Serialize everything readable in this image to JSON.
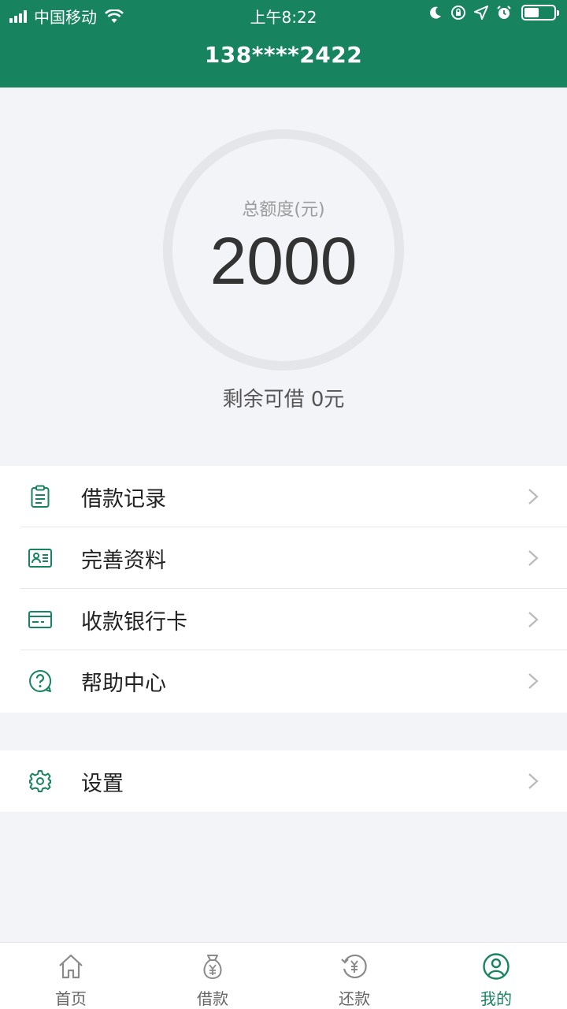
{
  "status_bar": {
    "carrier": "中国移动",
    "time": "上午8:22",
    "battery_level": 0.5
  },
  "header": {
    "phone": "138****2422"
  },
  "credit": {
    "label": "总额度(元)",
    "amount": "2000",
    "remaining": "剩余可借 0元"
  },
  "menu": {
    "items": [
      {
        "label": "借款记录",
        "icon": "clipboard-icon"
      },
      {
        "label": "完善资料",
        "icon": "id-card-icon"
      },
      {
        "label": "收款银行卡",
        "icon": "bank-card-icon"
      },
      {
        "label": "帮助中心",
        "icon": "help-chat-icon"
      }
    ],
    "settings": {
      "label": "设置",
      "icon": "gear-icon"
    }
  },
  "tabbar": {
    "tabs": [
      {
        "label": "首页",
        "icon": "home-icon",
        "active": false
      },
      {
        "label": "借款",
        "icon": "money-bag-icon",
        "active": false
      },
      {
        "label": "还款",
        "icon": "repay-icon",
        "active": false
      },
      {
        "label": "我的",
        "icon": "user-icon",
        "active": true
      }
    ]
  },
  "colors": {
    "brand": "#17845f",
    "background": "#f3f4f8",
    "inactive_tab": "#888888"
  }
}
